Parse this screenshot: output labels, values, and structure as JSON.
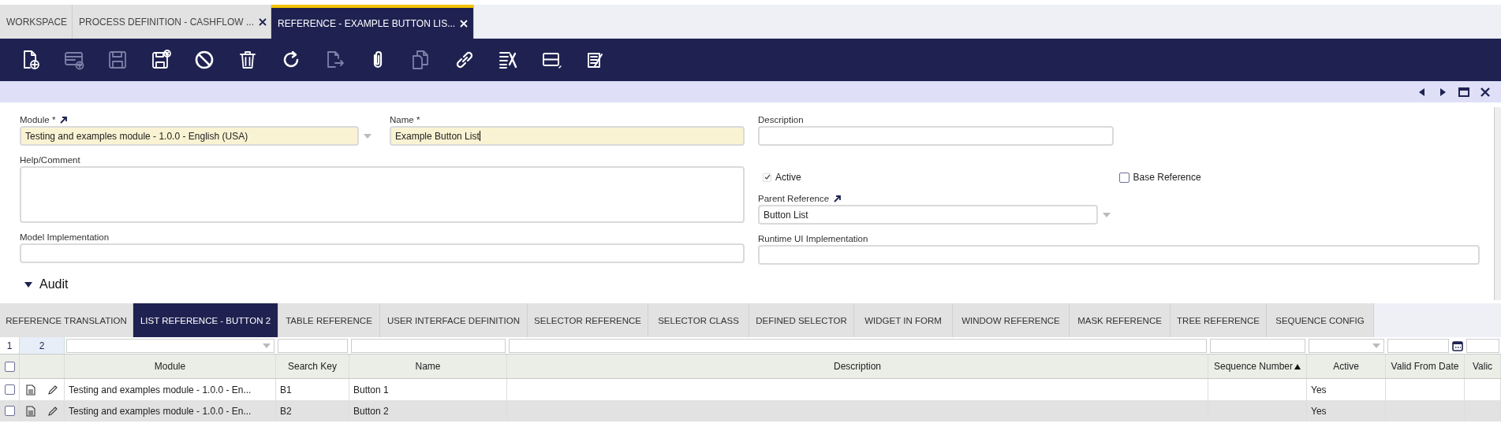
{
  "tabs": [
    {
      "label": "WORKSPACE",
      "selected": false,
      "closable": false
    },
    {
      "label": "PROCESS DEFINITION - CASHFLOW ...",
      "selected": false,
      "closable": true
    },
    {
      "label": "REFERENCE - EXAMPLE BUTTON LIS...",
      "selected": true,
      "closable": true
    }
  ],
  "toolbar": [
    {
      "kind": "new-document",
      "disabled": false
    },
    {
      "kind": "new-row",
      "disabled": true
    },
    {
      "kind": "save",
      "disabled": true
    },
    {
      "kind": "save-close",
      "disabled": false
    },
    {
      "kind": "cancel",
      "disabled": false
    },
    {
      "kind": "delete",
      "disabled": false
    },
    {
      "kind": "refresh",
      "disabled": false
    },
    {
      "kind": "export",
      "disabled": true
    },
    {
      "kind": "attach",
      "disabled": false
    },
    {
      "kind": "copy",
      "disabled": true
    },
    {
      "kind": "link",
      "disabled": false
    },
    {
      "kind": "tools",
      "disabled": false
    },
    {
      "kind": "layout",
      "disabled": false
    },
    {
      "kind": "note",
      "disabled": false
    }
  ],
  "form": {
    "module": {
      "label": "Module *",
      "value": "Testing and examples module - 1.0.0 - English (USA)",
      "required": true,
      "linked": true
    },
    "name": {
      "label": "Name *",
      "value": "Example Button List",
      "required": true
    },
    "description": {
      "label": "Description"
    },
    "help_comment": {
      "label": "Help/Comment"
    },
    "active": {
      "label": "Active",
      "checked": true,
      "disabled": true
    },
    "base_reference": {
      "label": "Base Reference",
      "checked": false,
      "disabled": false
    },
    "parent_reference": {
      "label": "Parent Reference",
      "value": "Button List",
      "linked": true
    },
    "model_implementation": {
      "label": "Model Implementation"
    },
    "runtime_ui_implementation": {
      "label": "Runtime UI Implementation"
    },
    "audit": {
      "label": "Audit"
    }
  },
  "subtabs": [
    {
      "label": "REFERENCE TRANSLATION",
      "selected": false
    },
    {
      "label": "LIST REFERENCE - BUTTON 2",
      "selected": true
    },
    {
      "label": "TABLE REFERENCE",
      "selected": false
    },
    {
      "label": "USER INTERFACE DEFINITION",
      "selected": false
    },
    {
      "label": "SELECTOR REFERENCE",
      "selected": false
    },
    {
      "label": "SELECTOR CLASS",
      "selected": false
    },
    {
      "label": "DEFINED SELECTOR",
      "selected": false
    },
    {
      "label": "WIDGET IN FORM",
      "selected": false
    },
    {
      "label": "WINDOW REFERENCE",
      "selected": false
    },
    {
      "label": "MASK REFERENCE",
      "selected": false
    },
    {
      "label": "TREE REFERENCE",
      "selected": false
    },
    {
      "label": "SEQUENCE CONFIG",
      "selected": false
    }
  ],
  "grid": {
    "filter_labels": [
      "1",
      "2"
    ],
    "select_all": false,
    "columns": [
      {
        "label": "Module",
        "kind": "dropdown",
        "sorted": false
      },
      {
        "label": "Search Key",
        "kind": "text",
        "sorted": false
      },
      {
        "label": "Name",
        "kind": "text",
        "sorted": false
      },
      {
        "label": "Description",
        "kind": "text",
        "sorted": false
      },
      {
        "label": "Sequence Number",
        "kind": "text",
        "sorted": true
      },
      {
        "label": "Active",
        "kind": "dropdown",
        "sorted": false
      },
      {
        "label": "Valid From Date",
        "kind": "date",
        "sorted": false
      },
      {
        "label": "Valic",
        "kind": "text",
        "sorted": false
      }
    ],
    "rows": [
      {
        "selected": false,
        "checked": false,
        "module": "Testing and examples module - 1.0.0 - En...",
        "search_key": "B1",
        "name": "Button 1",
        "active": "Yes"
      },
      {
        "selected": true,
        "checked": false,
        "module": "Testing and examples module - 1.0.0 - En...",
        "search_key": "B2",
        "name": "Button 2",
        "active": "Yes"
      }
    ]
  }
}
